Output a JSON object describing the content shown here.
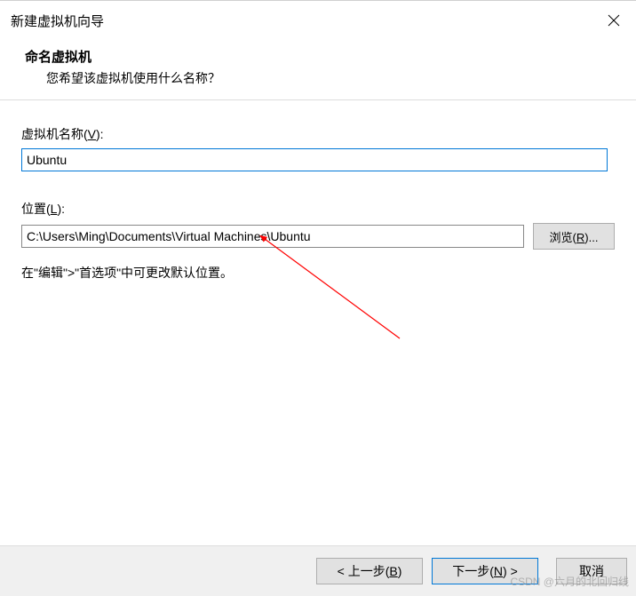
{
  "titlebar": {
    "title": "新建虚拟机向导"
  },
  "header": {
    "title": "命名虚拟机",
    "subtitle": "您希望该虚拟机使用什么名称？"
  },
  "nameField": {
    "label_pre": "虚拟机名称(",
    "label_u": "V",
    "label_post": "):",
    "value": "Ubuntu"
  },
  "locationField": {
    "label_pre": "位置(",
    "label_u": "L",
    "label_post": "):",
    "value": "C:\\Users\\Ming\\Documents\\Virtual Machines\\Ubuntu"
  },
  "browse": {
    "label_pre": "浏览(",
    "label_u": "R",
    "label_post": ")..."
  },
  "hint": "在\"编辑\">\"首选项\"中可更改默认位置。",
  "footer": {
    "back_pre": "< 上一步(",
    "back_u": "B",
    "back_post": ")",
    "next_pre": "下一步(",
    "next_u": "N",
    "next_post": ") >",
    "cancel": "取消"
  },
  "watermark": "CSDN @六月的北回归线"
}
